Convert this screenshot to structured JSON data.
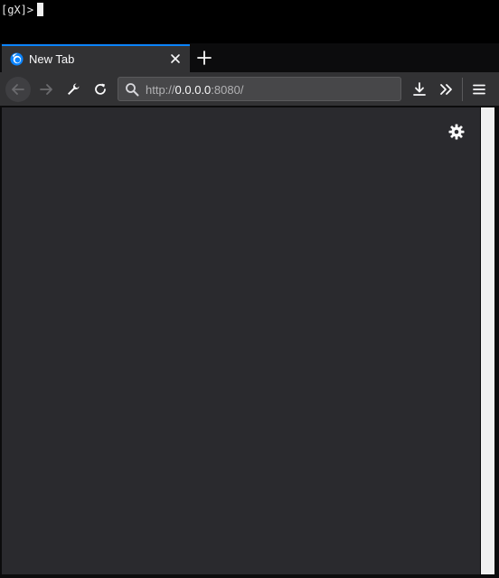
{
  "terminal": {
    "prompt": "[gX]>"
  },
  "tabs": [
    {
      "label": "New Tab",
      "active": true,
      "icon": "firefox-logo-icon"
    }
  ],
  "toolbar": {
    "back_icon": "arrow-left-icon",
    "forward_icon": "arrow-right-icon",
    "tools_icon": "wrench-icon",
    "reload_icon": "reload-icon",
    "downloads_icon": "download-icon",
    "overflow_icon": "chevron-double-right-icon",
    "menu_icon": "hamburger-menu-icon"
  },
  "urlbar": {
    "prefix": "http://",
    "host": "0.0.0.0",
    "suffix": ":8080/"
  },
  "content": {
    "settings_icon": "gear-icon"
  },
  "colors": {
    "accent": "#0a84ff",
    "toolbar_bg": "#323234",
    "content_bg": "#2a2a2e",
    "frame_bg": "#0c0c0d"
  }
}
